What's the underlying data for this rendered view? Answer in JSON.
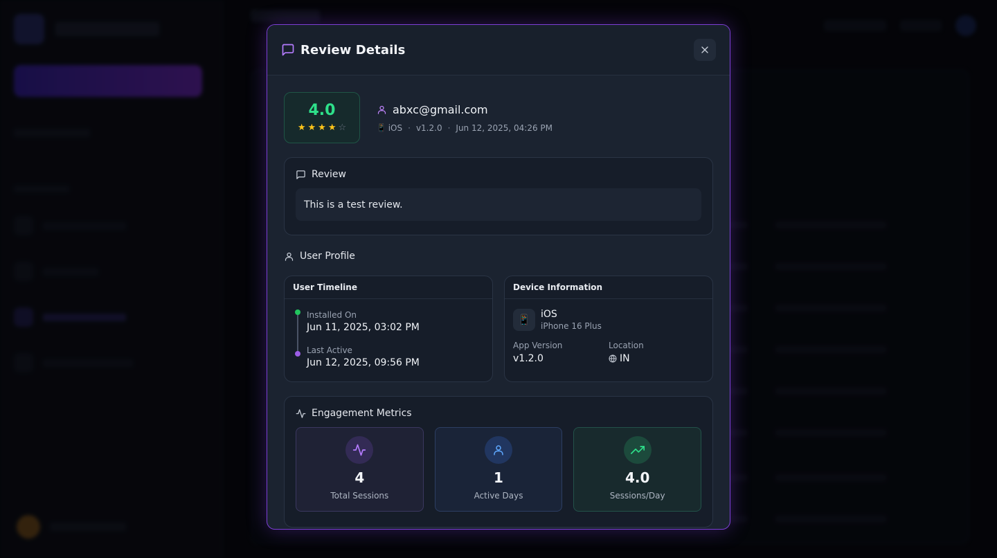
{
  "modal": {
    "title": "Review Details",
    "close_icon": "close-icon"
  },
  "summary": {
    "rating": "4.0",
    "stars": {
      "filled": 4,
      "total": 5
    },
    "email": "abxc@gmail.com",
    "platform": "iOS",
    "version": "v1.2.0",
    "date": "Jun 12, 2025, 04:26 PM"
  },
  "review": {
    "heading": "Review",
    "text": "This is a test review."
  },
  "profile": {
    "heading": "User Profile",
    "timeline": {
      "title": "User Timeline",
      "installed_label": "Installed On",
      "installed_value": "Jun 11, 2025, 03:02 PM",
      "last_active_label": "Last Active",
      "last_active_value": "Jun 12, 2025, 09:56 PM"
    },
    "device": {
      "title": "Device Information",
      "os": "iOS",
      "model": "iPhone 16 Plus",
      "app_version_label": "App Version",
      "app_version": "v1.2.0",
      "location_label": "Location",
      "location": "IN"
    }
  },
  "metrics": {
    "heading": "Engagement Metrics",
    "items": [
      {
        "value": "4",
        "label": "Total Sessions",
        "icon": "activity-icon",
        "color": "#b57cff"
      },
      {
        "value": "1",
        "label": "Active Days",
        "icon": "user-icon",
        "color": "#5ea8ff"
      },
      {
        "value": "4.0",
        "label": "Sessions/Day",
        "icon": "trending-up-icon",
        "color": "#2ee08a"
      }
    ]
  },
  "colors": {
    "accent": "#7d3fd6",
    "rating_green": "#2ee08a",
    "star_yellow": "#ffc61a"
  }
}
